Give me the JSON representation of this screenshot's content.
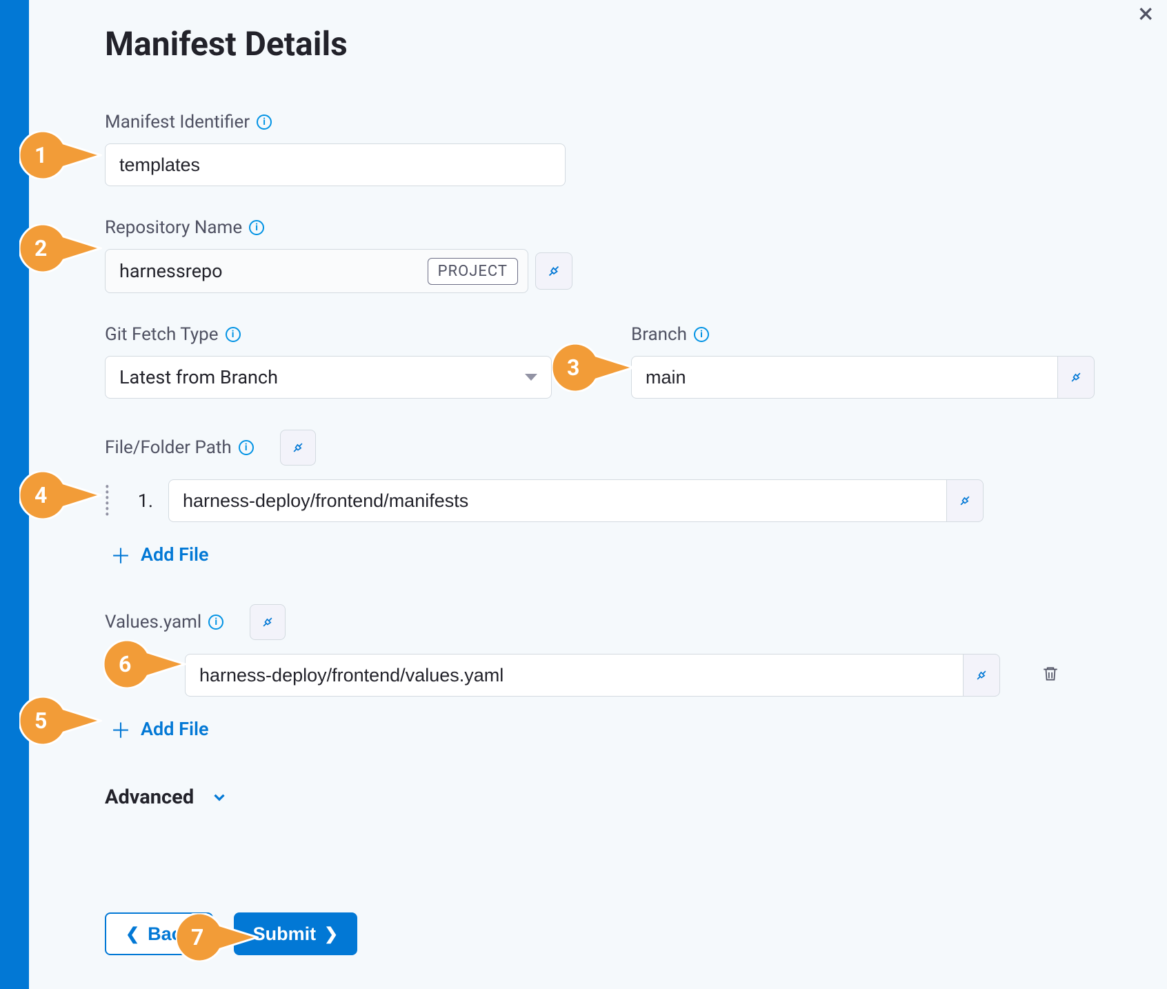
{
  "page": {
    "title": "Manifest Details"
  },
  "fields": {
    "manifest_identifier": {
      "label": "Manifest Identifier",
      "value": "templates"
    },
    "repository_name": {
      "label": "Repository Name",
      "value": "harnessrepo",
      "scope_badge": "PROJECT"
    },
    "git_fetch_type": {
      "label": "Git Fetch Type",
      "value": "Latest from Branch"
    },
    "branch": {
      "label": "Branch",
      "value": "main"
    },
    "file_folder_path": {
      "label": "File/Folder Path",
      "rows": [
        {
          "index": "1.",
          "value": "harness-deploy/frontend/manifests"
        }
      ]
    },
    "values_yaml": {
      "label": "Values.yaml",
      "rows": [
        {
          "value": "harness-deploy/frontend/values.yaml"
        }
      ]
    }
  },
  "actions": {
    "add_file": "Add File",
    "advanced": "Advanced",
    "back": "Back",
    "submit": "Submit"
  },
  "markers": {
    "m1": "1",
    "m2": "2",
    "m3": "3",
    "m4": "4",
    "m5": "5",
    "m6": "6",
    "m7": "7"
  },
  "colors": {
    "accent": "#0278d5",
    "marker": "#f29c38"
  }
}
